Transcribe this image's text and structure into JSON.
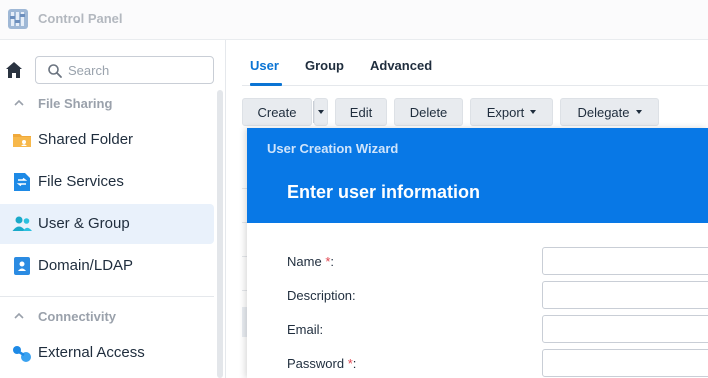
{
  "app": {
    "title": "Control Panel"
  },
  "sidebar": {
    "search_placeholder": "Search",
    "sections": [
      {
        "label": "File Sharing",
        "items": [
          {
            "label": "Shared Folder",
            "icon": "folder-icon"
          },
          {
            "label": "File Services",
            "icon": "file-services-icon"
          },
          {
            "label": "User & Group",
            "icon": "users-icon",
            "active": true
          },
          {
            "label": "Domain/LDAP",
            "icon": "domain-icon"
          }
        ]
      },
      {
        "label": "Connectivity",
        "items": [
          {
            "label": "External Access",
            "icon": "external-access-icon"
          }
        ]
      }
    ]
  },
  "main": {
    "tabs": [
      {
        "label": "User",
        "active": true
      },
      {
        "label": "Group"
      },
      {
        "label": "Advanced"
      }
    ],
    "toolbar": {
      "create": "Create",
      "edit": "Edit",
      "delete": "Delete",
      "export": "Export",
      "delegate": "Delegate"
    }
  },
  "wizard": {
    "title": "User Creation Wizard",
    "step_title": "Enter user information",
    "fields": [
      {
        "label": "Name",
        "required": true,
        "suffix": ":",
        "value": ""
      },
      {
        "label": "Description:",
        "required": false,
        "value": ""
      },
      {
        "label": "Email:",
        "required": false,
        "value": ""
      },
      {
        "label": "Password",
        "required": true,
        "suffix": ":",
        "value": ""
      }
    ]
  },
  "colors": {
    "accent": "#0a74d4",
    "wizard_header": "#0878e6",
    "active_nav_bg": "#e9f1fb",
    "required": "#e0454f"
  }
}
